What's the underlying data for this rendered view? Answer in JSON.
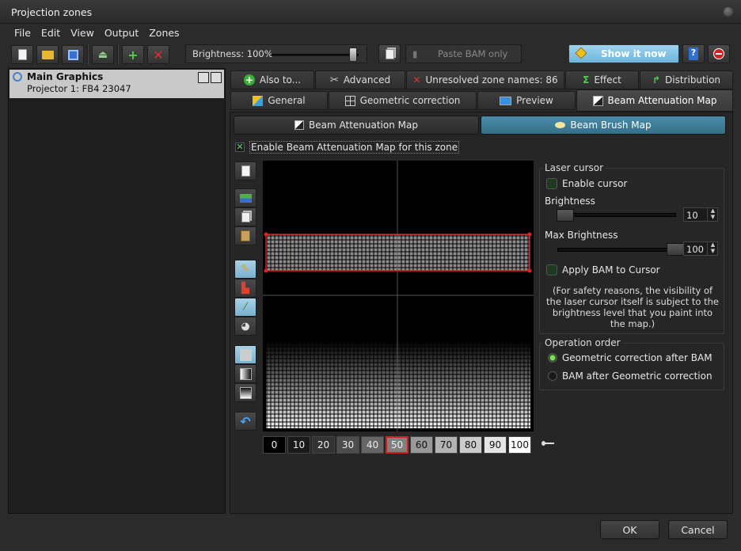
{
  "window": {
    "title": "Projection zones"
  },
  "menu": [
    "File",
    "Edit",
    "View",
    "Output",
    "Zones"
  ],
  "toolbar": {
    "brightness_label": "Brightness: 100%",
    "brightness_level": 1.0,
    "paste_bam_label": "Paste BAM only",
    "show_label": "Show it now"
  },
  "zones": [
    {
      "name": "Main Graphics",
      "projector": "Projector 1: FB4 23047"
    }
  ],
  "tabs_row1": [
    "Also to...",
    "Advanced",
    "Unresolved zone names: 86",
    "Effect",
    "Distribution"
  ],
  "tabs_row2": [
    "General",
    "Geometric correction",
    "Preview",
    "Beam Attenuation Map"
  ],
  "subtabs": [
    "Beam Attenuation Map",
    "Beam Brush Map"
  ],
  "enable_bam_label": "Enable Beam Attenuation Map for this zone",
  "value_buttons": [
    "0",
    "10",
    "20",
    "30",
    "40",
    "50",
    "60",
    "70",
    "80",
    "90",
    "100"
  ],
  "selected_value": "50",
  "laser_cursor": {
    "title": "Laser cursor",
    "enable_label": "Enable cursor",
    "brightness_label": "Brightness",
    "brightness_value": "10",
    "max_brightness_label": "Max Brightness",
    "max_brightness_value": "100",
    "apply_label": "Apply BAM to Cursor",
    "note": "(For safety reasons, the visibility of the laser cursor itself is subject to the brightness level that you paint into the map.)"
  },
  "operation_order": {
    "title": "Operation order",
    "option1": "Geometric correction after BAM",
    "option2": "BAM after Geometric correction",
    "selected": "Geometric correction after BAM"
  },
  "footer": {
    "ok": "OK",
    "cancel": "Cancel"
  },
  "colors": {
    "accent": "#6cb4dc",
    "selected_border": "#d02020",
    "led_on": "#6ed36e"
  }
}
